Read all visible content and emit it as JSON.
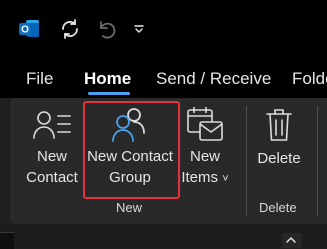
{
  "tabs": [
    "File",
    "Home",
    "Send / Receive",
    "Folde"
  ],
  "ribbon": {
    "new_contact": [
      "New",
      "Contact"
    ],
    "new_contact_group": [
      "New Contact",
      "Group"
    ],
    "new_items": [
      "New",
      "Items"
    ],
    "new_items_dropdown": "˅",
    "delete": "Delete",
    "group_new": "New",
    "group_delete": "Delete"
  },
  "colors": {
    "accent": "#4aa0f0",
    "highlight": "#e5323d",
    "brand_outlook": "#0f6cbd"
  }
}
